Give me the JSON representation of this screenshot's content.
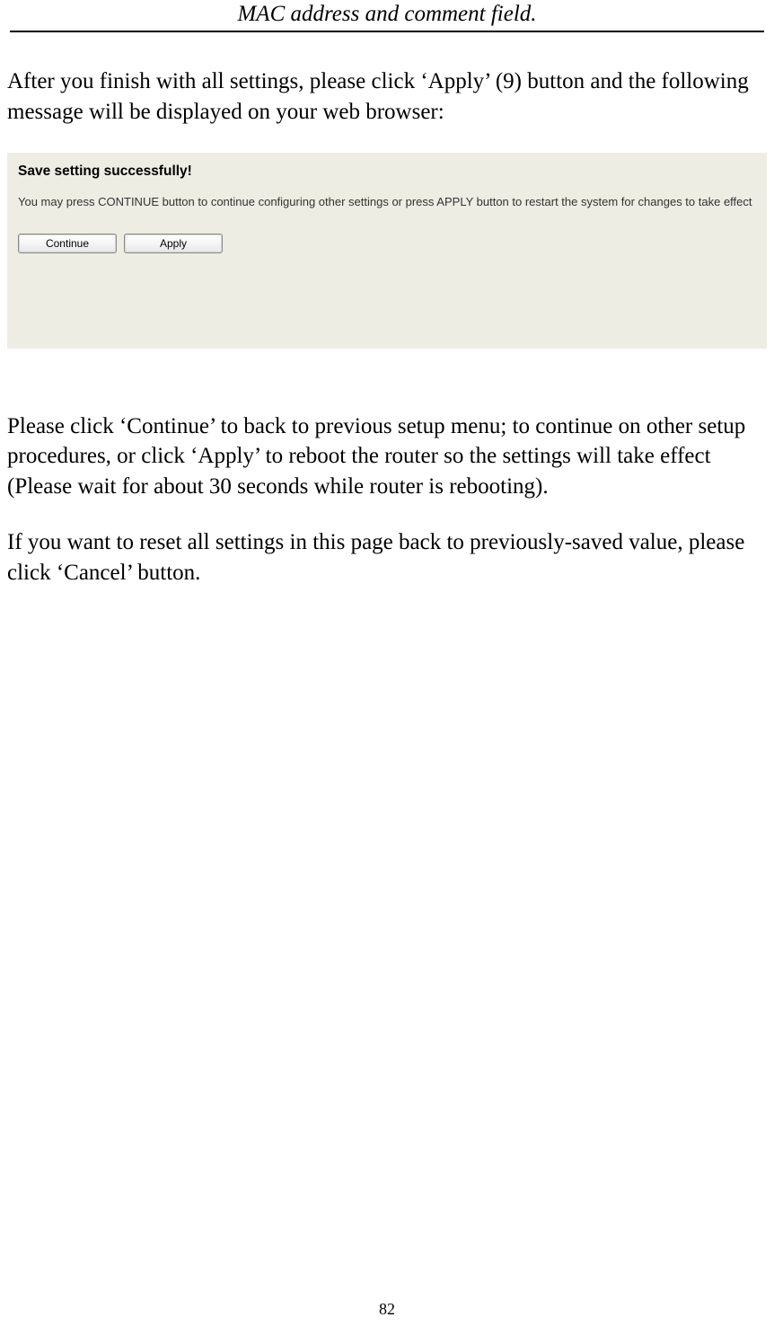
{
  "header": {
    "title": "MAC address and comment field."
  },
  "paragraphs": {
    "intro": "After you finish with all settings, please click ‘Apply’ (9) button and the following message will be displayed on your web browser:",
    "continue_explain": "Please click ‘Continue’ to back to previous setup menu; to continue on other setup procedures, or click ‘Apply’ to reboot the router so the settings will take effect (Please wait for about 30 seconds while router is rebooting).",
    "cancel_explain": "If you want to reset all settings in this page back to previously-saved value, please click ‘Cancel’ button."
  },
  "panel": {
    "title": "Save setting successfully!",
    "description": "You may press CONTINUE button to continue configuring other settings or press APPLY button to restart the system for changes to take effect",
    "buttons": {
      "continue": "Continue",
      "apply": "Apply"
    }
  },
  "page_number": "82"
}
